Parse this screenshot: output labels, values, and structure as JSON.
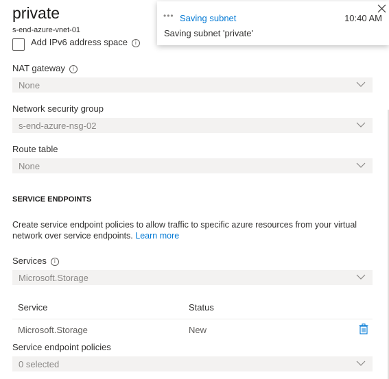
{
  "panel": {
    "title": "private",
    "subtitle": "s-end-azure-vnet-01",
    "ipv6_checkbox_label": "Add IPv6 address space",
    "nat_gateway": {
      "label": "NAT gateway",
      "value": "None"
    },
    "network_security_group": {
      "label": "Network security group",
      "value": "s-end-azure-nsg-02"
    },
    "route_table": {
      "label": "Route table",
      "value": "None"
    },
    "service_endpoints": {
      "heading": "SERVICE ENDPOINTS",
      "description": "Create service endpoint policies to allow traffic to specific azure resources from your virtual network over service endpoints.",
      "learn_more": "Learn more",
      "services_label": "Services",
      "services_value": "Microsoft.Storage",
      "table": {
        "headers": [
          "Service",
          "Status"
        ],
        "rows": [
          {
            "service": "Microsoft.Storage",
            "status": "New"
          }
        ]
      },
      "policies_label": "Service endpoint policies",
      "policies_value": "0 selected"
    }
  },
  "toast": {
    "dots": "•••",
    "title": "Saving subnet",
    "time": "10:40 AM",
    "message": "Saving subnet 'private'"
  }
}
